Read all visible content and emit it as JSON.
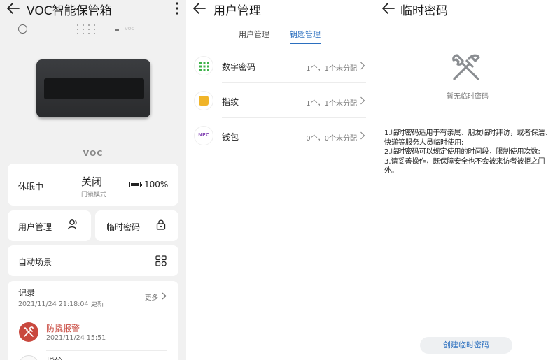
{
  "home": {
    "title": "VOC智能保管箱",
    "brand": "VOC",
    "status": {
      "state_label": "休眠中",
      "lock_state": "关闭",
      "lock_mode": "门锁模式",
      "battery_pct": 100,
      "battery_text": "100%"
    },
    "tiles": {
      "user_mgmt": "用户管理",
      "temp_password": "临时密码",
      "auto_scene": "自动场景"
    },
    "records": {
      "title": "记录",
      "updated": "2021/11/24 21:18:04 更新",
      "more": "更多",
      "items": [
        {
          "title": "防撬报警",
          "time": "2021/11/24 15:51"
        }
      ],
      "next_partial": "指纹"
    }
  },
  "user_mgmt": {
    "title": "用户管理",
    "tabs": [
      "用户管理",
      "钥匙管理"
    ],
    "active_tab": 1,
    "rows": [
      {
        "label": "数字密码",
        "value": "1个，1个未分配"
      },
      {
        "label": "指纹",
        "value": "1个，1个未分配"
      },
      {
        "label": "钱包",
        "value": "0个，0个未分配",
        "icon_text": "NFC"
      }
    ]
  },
  "temp_pw": {
    "title": "临时密码",
    "empty": "暂无临时密码",
    "desc": [
      "1.临时密码适用于有亲属、朋友临时拜访，或者保洁、快递等服务人员临时使用;",
      "2.临时密码可以规定使用的时间段，限制使用次数;",
      "3.请妥善操作，既保障安全也不会被来访者被拒之门外。"
    ],
    "create_button": "创建临时密码"
  },
  "colors": {
    "accent": "#2b6fbf",
    "alarm": "#c9483e",
    "keypad_green": "#3db34a",
    "fingerprint_amber": "#f0b429",
    "nfc_purple": "#8a4fb8"
  },
  "icons": [
    "back-arrow-icon",
    "more-vert-icon",
    "user-icon",
    "lock-icon",
    "grid-icon",
    "chevron-right-icon",
    "tools-icon",
    "keypad-icon",
    "fingerprint-icon",
    "nfc-icon",
    "alarm-icon",
    "battery-icon"
  ]
}
